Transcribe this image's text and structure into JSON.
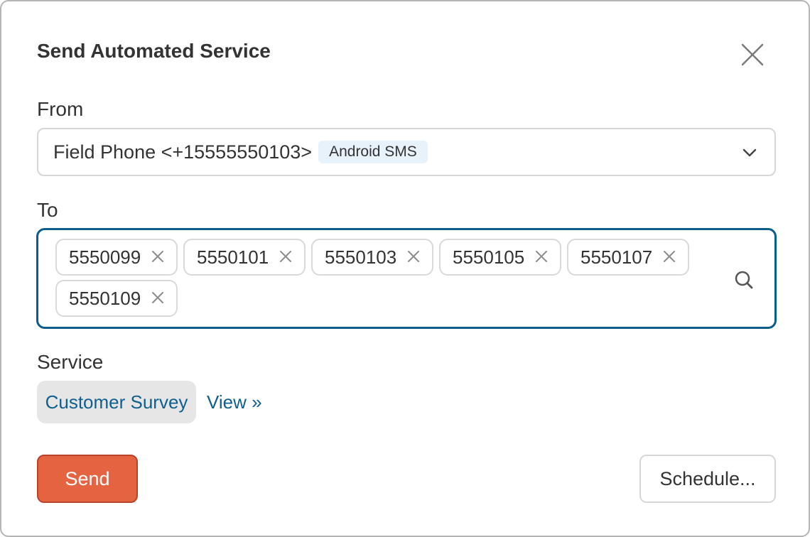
{
  "dialog": {
    "title": "Send Automated Service"
  },
  "from": {
    "label": "From",
    "value": "Field Phone <+15555550103>",
    "badge": "Android SMS"
  },
  "to": {
    "label": "To",
    "recipients": [
      "5550099",
      "5550101",
      "5550103",
      "5550105",
      "5550107",
      "5550109"
    ]
  },
  "service": {
    "label": "Service",
    "selected": "Customer Survey",
    "view_link": "View »"
  },
  "actions": {
    "send_label": "Send",
    "schedule_label": "Schedule..."
  },
  "icons": {
    "close": "close-icon",
    "dropdown": "chevron-down-icon",
    "tag_remove": "close-icon",
    "search": "search-icon"
  },
  "colors": {
    "focus_border": "#0c5c8c",
    "link": "#0f5f8f",
    "primary_button": "#e46442",
    "badge_bg": "#e8f2fb"
  }
}
